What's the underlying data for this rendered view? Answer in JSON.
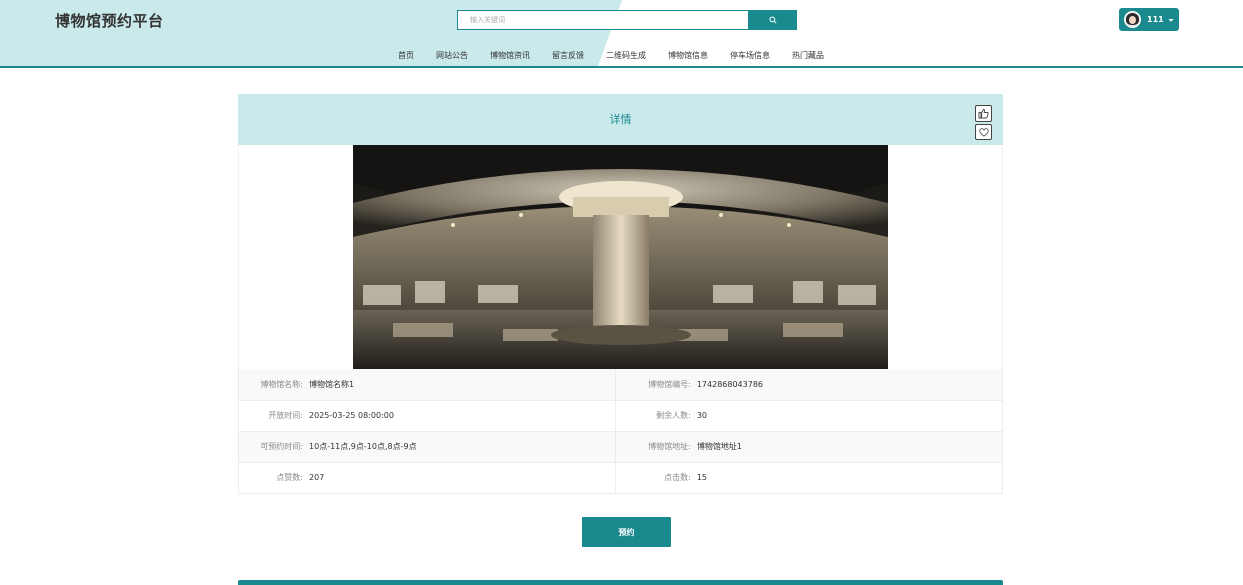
{
  "header": {
    "logo": "博物馆预约平台",
    "search": {
      "placeholder": "输入关键词",
      "button_icon": "search-icon"
    },
    "nav": [
      "首页",
      "网站公告",
      "博物馆资讯",
      "留言反馈",
      "二维码生成",
      "博物馆信息",
      "停车场信息",
      "热门藏品"
    ],
    "user": {
      "name": "111",
      "dropdown_icon": "caret-down-icon"
    }
  },
  "panel": {
    "title": "详情",
    "like_icon": "thumbs-up-icon",
    "favorite_icon": "heart-icon"
  },
  "details": {
    "name_label": "博物馆名称:",
    "name_value": "博物馆名称1",
    "code_label": "博物馆编号:",
    "code_value": "1742868043786",
    "open_time_label": "开放时间:",
    "open_time_value": "2025-03-25 08:00:00",
    "remaining_label": "剩余人数:",
    "remaining_value": "30",
    "slots_label": "可预约时间:",
    "slots_value": "10点-11点,9点-10点,8点-9点",
    "address_label": "博物馆地址:",
    "address_value": "博物馆地址1",
    "likes_label": "点赞数:",
    "likes_value": "207",
    "clicks_label": "点击数:",
    "clicks_value": "15"
  },
  "actions": {
    "book_label": "预约"
  },
  "colors": {
    "accent": "#1a8a8f",
    "header_light": "#c9e9ea"
  }
}
